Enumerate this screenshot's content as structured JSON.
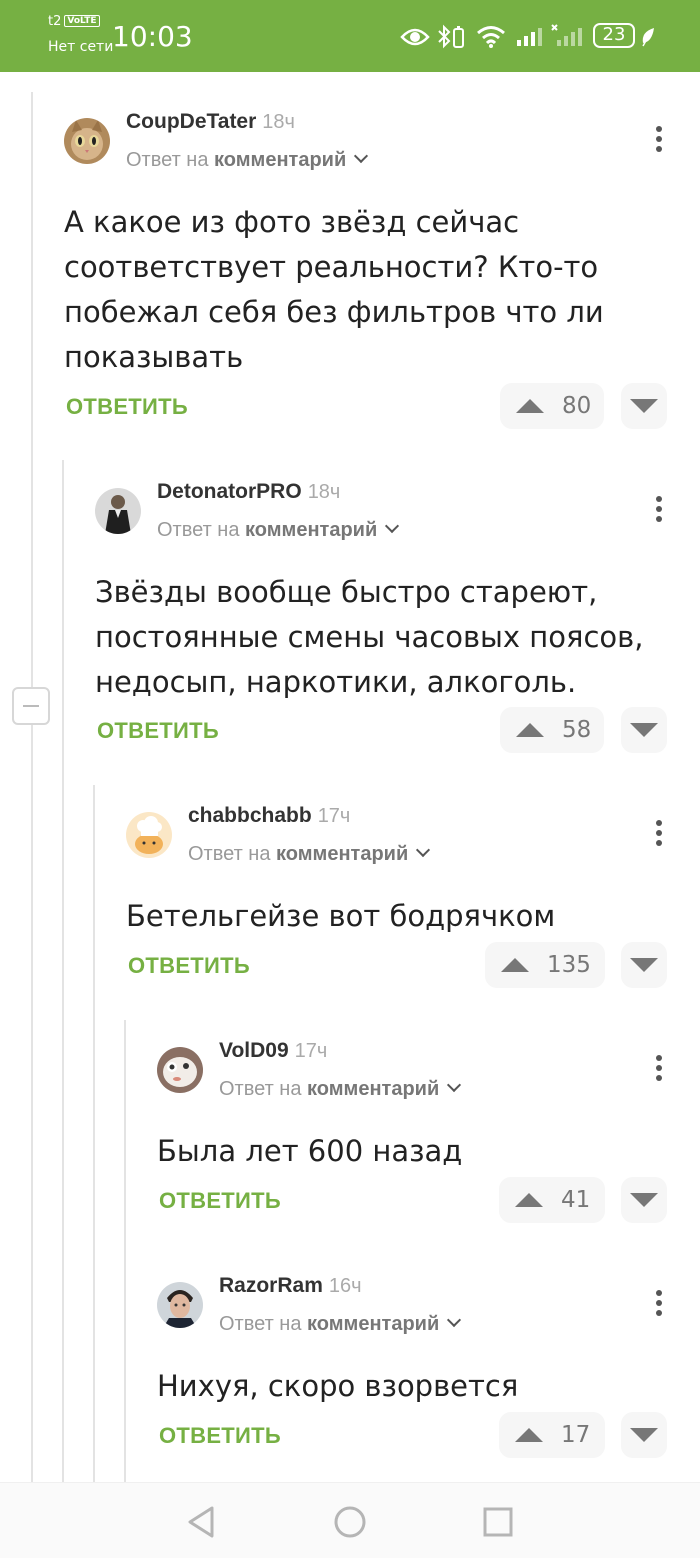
{
  "status_bar": {
    "carrier": "t2",
    "volte": "VoLTE",
    "network": "Нет сети",
    "time": "10:03",
    "battery": "23"
  },
  "colors": {
    "brand": "#76b043",
    "text": "#222222",
    "muted": "#999999"
  },
  "comments": [
    {
      "username": "CoupDeTater",
      "time": "18ч",
      "reply_prefix": "Ответ на",
      "reply_target": "комментарий",
      "lines": [
        "А какое из фото звёзд сейчас",
        "соответствует реальности? Кто-то",
        "побежал себя без фильтров что ли",
        "показывать"
      ],
      "reply_label": "ОТВЕТИТЬ",
      "votes": "80",
      "avatar": "cat-avatar"
    },
    {
      "username": "DetonatorPRO",
      "time": "18ч",
      "reply_prefix": "Ответ на",
      "reply_target": "комментарий",
      "lines": [
        "Звёзды вообще быстро стареют,",
        "постоянные смены часовых поясов,",
        "недосып, наркотики, алкоголь."
      ],
      "reply_label": "ОТВЕТИТЬ",
      "votes": "58",
      "avatar": "man-in-suit-avatar"
    },
    {
      "username": "chabbchabb",
      "time": "17ч",
      "reply_prefix": "Ответ на",
      "reply_target": "комментарий",
      "lines": [
        "Бетельгейзе вот бодрячком"
      ],
      "reply_label": "ОТВЕТИТЬ",
      "votes": "135",
      "avatar": "chef-hat-avatar"
    },
    {
      "username": "VolD09",
      "time": "17ч",
      "reply_prefix": "Ответ на",
      "reply_target": "комментарий",
      "lines": [
        "Была лет 600 назад"
      ],
      "reply_label": "ОТВЕТИТЬ",
      "votes": "41",
      "avatar": "toy-avatar"
    },
    {
      "username": "RazorRam",
      "time": "16ч",
      "reply_prefix": "Ответ на",
      "reply_target": "комментарий",
      "lines": [
        "Нихуя, скоро взорвется"
      ],
      "reply_label": "ОТВЕТИТЬ",
      "votes": "17",
      "avatar": "man-portrait-avatar"
    }
  ],
  "nav": {
    "back": "back-icon",
    "home": "home-icon",
    "recents": "recents-icon"
  }
}
